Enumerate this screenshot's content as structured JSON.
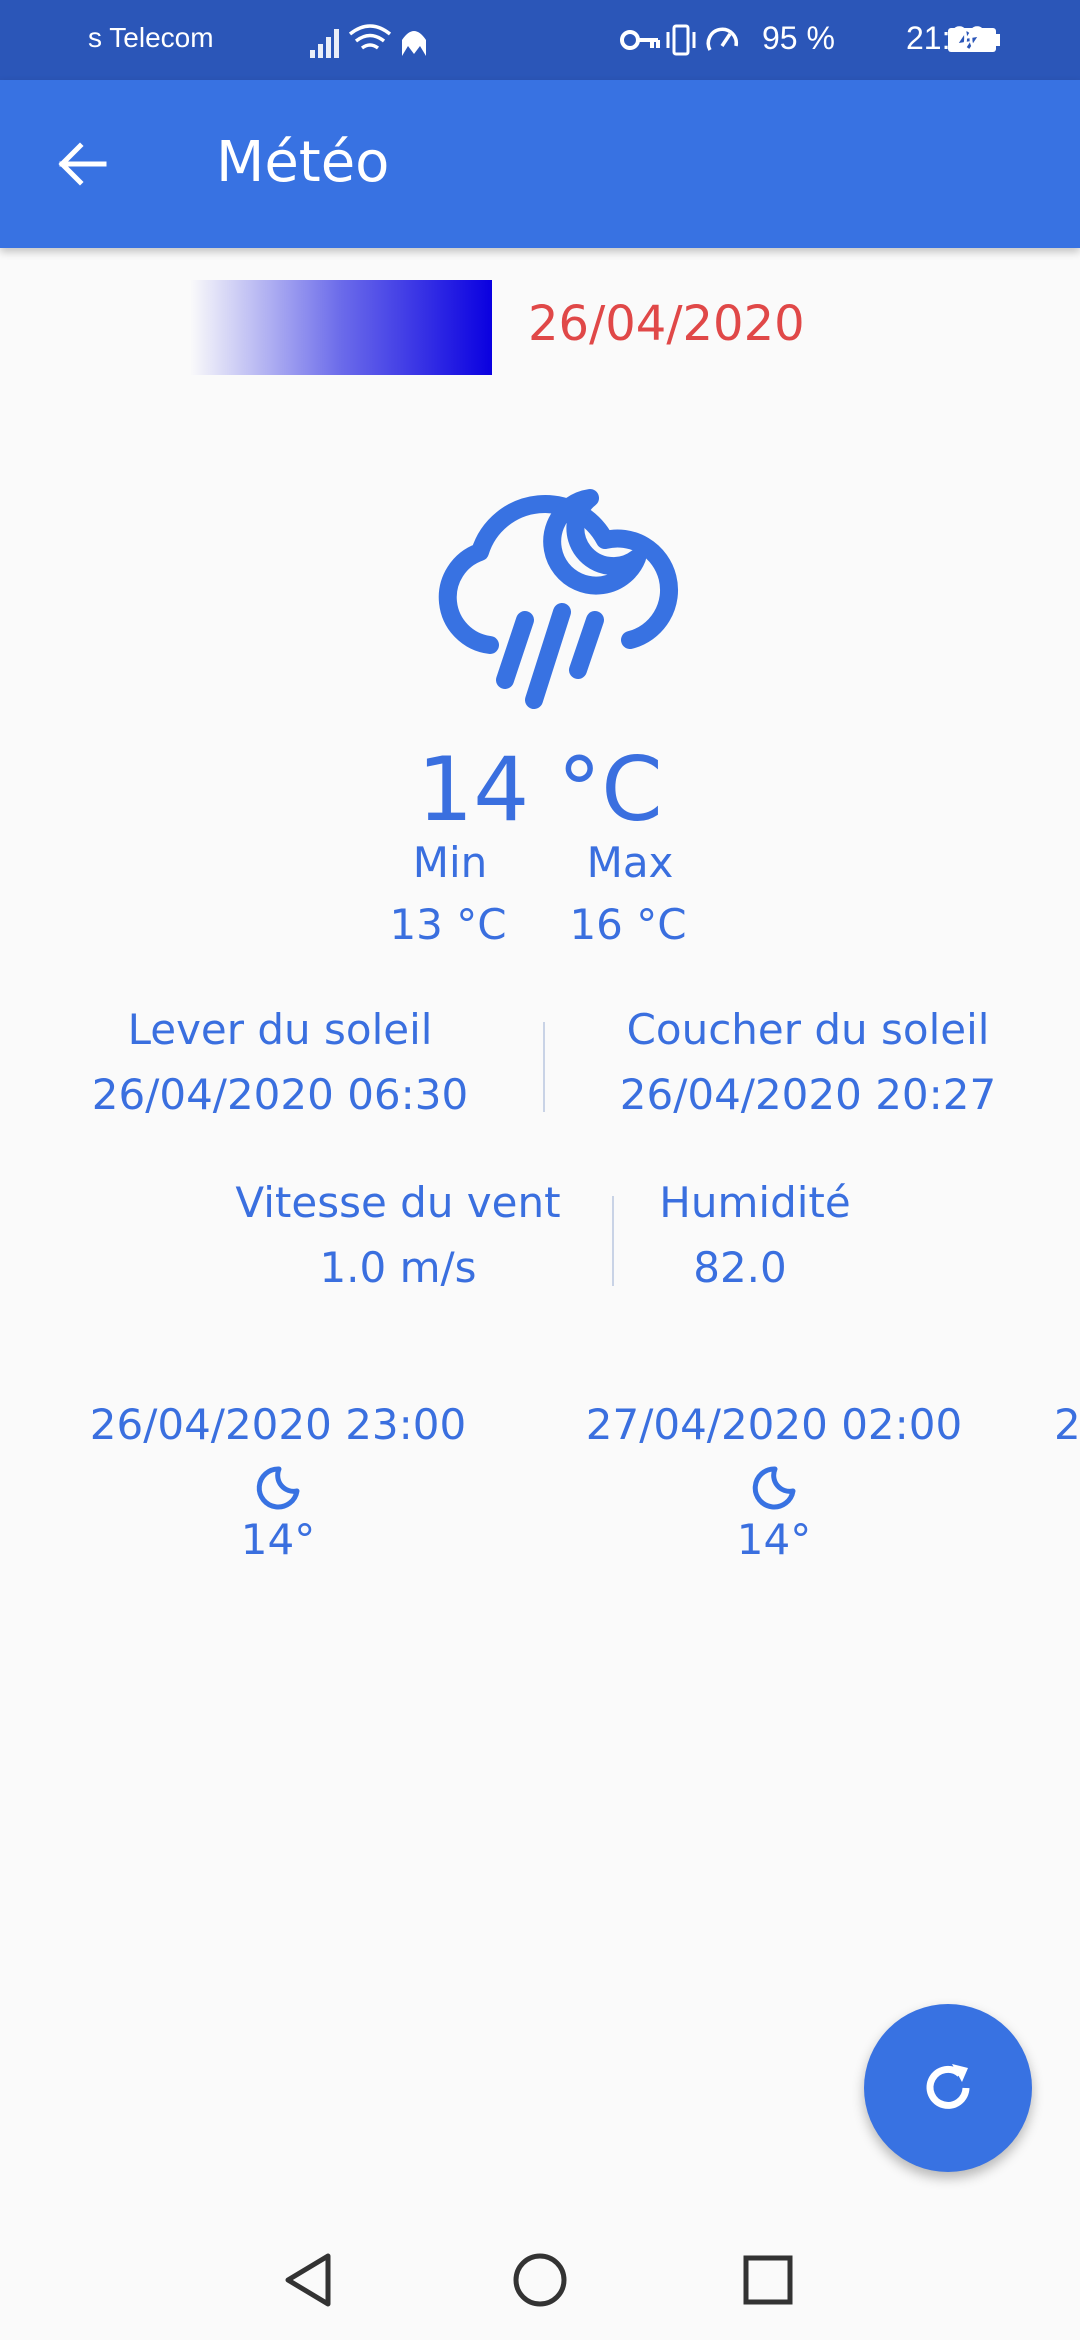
{
  "status_bar": {
    "carrier": "s Telecom",
    "battery_text": "95 %",
    "time": "21:00",
    "icons": [
      "signal-icon",
      "wifi-icon",
      "vpn-key-icon",
      "vibrate-icon",
      "data-saver-icon",
      "battery-charging-icon"
    ]
  },
  "app_bar": {
    "title": "Météo",
    "back_icon": "arrow-left-icon"
  },
  "date_header": "26/04/2020",
  "current": {
    "icon": "rain-cloud-moon-icon",
    "temperature": "14 °C",
    "min_label": "Min",
    "max_label": "Max",
    "min_value": "13 °C",
    "max_value": "16 °C"
  },
  "sun": {
    "sunrise_label": "Lever du soleil",
    "sunrise_value": "26/04/2020 06:30",
    "sunset_label": "Coucher du soleil",
    "sunset_value": "26/04/2020 20:27"
  },
  "wind_humidity": {
    "wind_label": "Vitesse du vent",
    "wind_value": "1.0 m/s",
    "humidity_label": "Humidité",
    "humidity_value": "82.0"
  },
  "forecast": [
    {
      "time": "26/04/2020 23:00",
      "icon": "moon-icon",
      "temp": "14°"
    },
    {
      "time": "27/04/2020 02:00",
      "icon": "moon-icon",
      "temp": "14°"
    },
    {
      "time": "2",
      "icon": "",
      "temp": ""
    }
  ],
  "fab": {
    "icon": "refresh-icon"
  },
  "nav": {
    "icons": [
      "back-triangle-icon",
      "home-circle-icon",
      "recents-square-icon"
    ]
  },
  "colors": {
    "status_bar": "#2b56b8",
    "app_bar": "#3872e2",
    "accent_text": "#3a6fdf",
    "date_red": "#e04848",
    "background": "#fafafa"
  }
}
